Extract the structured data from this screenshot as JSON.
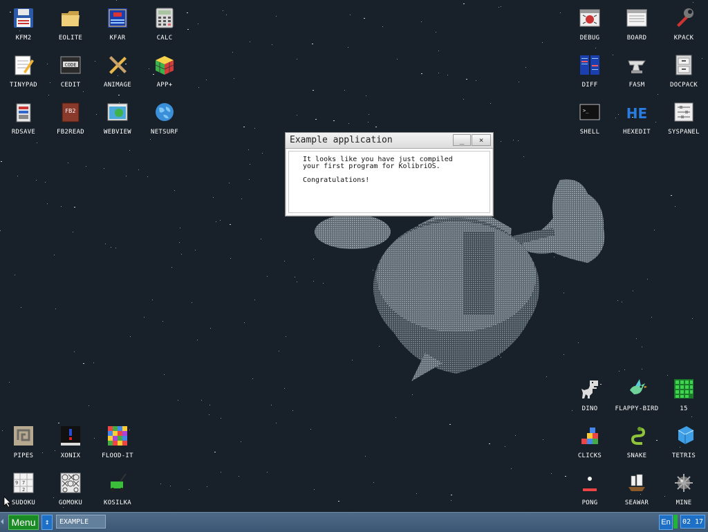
{
  "desktop": {
    "icons_left": [
      {
        "label": "KFM2",
        "icon": "floppy-disk-icon"
      },
      {
        "label": "EOLITE",
        "icon": "folder-icon"
      },
      {
        "label": "KFAR",
        "icon": "blue-panel-icon"
      },
      {
        "label": "CALC",
        "icon": "calculator-icon"
      },
      {
        "label": "TINYPAD",
        "icon": "notepad-icon"
      },
      {
        "label": "CEDIT",
        "icon": "code-editor-icon"
      },
      {
        "label": "ANIMAGE",
        "icon": "pencil-ruler-icon"
      },
      {
        "label": "APP+",
        "icon": "rubik-cube-icon"
      },
      {
        "label": "RDSAVE",
        "icon": "ram-disk-icon"
      },
      {
        "label": "FB2READ",
        "icon": "book-icon"
      },
      {
        "label": "WEBVIEW",
        "icon": "web-page-icon"
      },
      {
        "label": "NETSURF",
        "icon": "globe-icon"
      }
    ],
    "icons_right": [
      {
        "label": "DEBUG",
        "icon": "bug-icon"
      },
      {
        "label": "BOARD",
        "icon": "board-icon"
      },
      {
        "label": "KPACK",
        "icon": "wrench-icon"
      },
      {
        "label": "DIFF",
        "icon": "diff-icon"
      },
      {
        "label": "FASM",
        "icon": "anvil-icon"
      },
      {
        "label": "DOCPACK",
        "icon": "cabinet-icon"
      },
      {
        "label": "SHELL",
        "icon": "terminal-icon"
      },
      {
        "label": "HEXEDIT",
        "icon": "hex-icon"
      },
      {
        "label": "SYSPANEL",
        "icon": "sliders-icon"
      }
    ],
    "icons_bottom_left": [
      {
        "label": "PIPES",
        "icon": "pipes-icon"
      },
      {
        "label": "XONIX",
        "icon": "xonix-icon"
      },
      {
        "label": "FLOOD-IT",
        "icon": "flood-grid-icon"
      },
      {
        "label": "SUDOKU",
        "icon": "sudoku-icon"
      },
      {
        "label": "GOMOKU",
        "icon": "gomoku-icon"
      },
      {
        "label": "KOSILKA",
        "icon": "lawnmower-icon"
      }
    ],
    "icons_bottom_right": [
      {
        "label": "DINO",
        "icon": "dino-icon"
      },
      {
        "label": "FLAPPY-BIRD",
        "icon": "bird-icon"
      },
      {
        "label": "15",
        "icon": "fifteen-grid-icon"
      },
      {
        "label": "CLICKS",
        "icon": "blocks-icon"
      },
      {
        "label": "SNAKE",
        "icon": "snake-icon"
      },
      {
        "label": "TETRIS",
        "icon": "tetris-icon"
      },
      {
        "label": "PONG",
        "icon": "pong-icon"
      },
      {
        "label": "SEAWAR",
        "icon": "ship-icon"
      },
      {
        "label": "MINE",
        "icon": "mine-icon"
      }
    ]
  },
  "window": {
    "title": "Example application",
    "minimize_label": "_",
    "close_label": "×",
    "lines": [
      "It looks like you have just compiled",
      "your first program for KolibriOS.",
      "Congratulations!"
    ]
  },
  "taskbar": {
    "menu_label": "Menu",
    "switch_label": "↕",
    "task_label": "EXAMPLE",
    "lang": "En",
    "time": "02 17"
  },
  "colors": {
    "background": "#182029",
    "taskbar": "#445f7c",
    "menu": "#1a8a25",
    "accent": "#1d70c6"
  }
}
